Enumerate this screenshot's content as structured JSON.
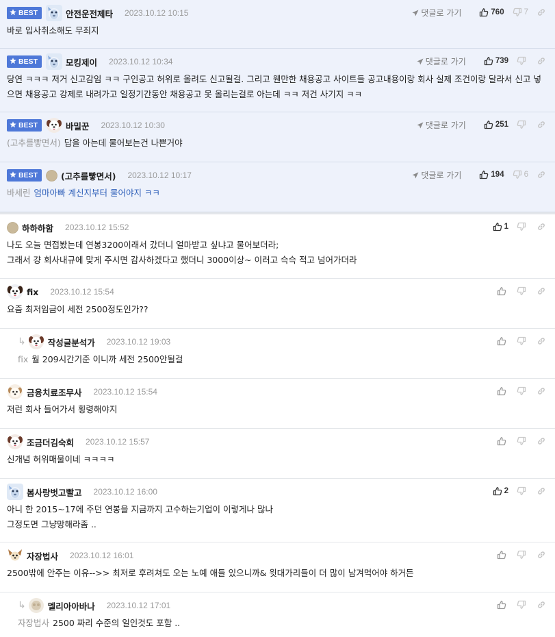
{
  "ui": {
    "goto_label": "댓글로 가기",
    "best_label": "BEST"
  },
  "comments": [
    {
      "nick": "안전운전제타",
      "time": "2023.10.12 10:15",
      "best": true,
      "goto": true,
      "up": "760",
      "down": "7",
      "text": "바로 입사취소해도 무죄지",
      "avatar": "blue-pet-avatar"
    },
    {
      "nick": "모킹제이",
      "time": "2023.10.12 10:34",
      "best": true,
      "goto": true,
      "up": "739",
      "down": "",
      "text": "당연 ㅋㅋㅋ 저거 신고감임 ㅋㅋ 구인공고 허위로 올려도 신고될걸. 그리고 웬만한 채용공고 사이트들 공고내용이랑 회사 실제 조건이랑 달라서 신고 넣으면 채용공고 강제로 내려가고 일정기간동안 채용공고 못 올리는걸로 아는데 ㅋㅋ 저건 사기지 ㅋㅋ",
      "avatar": "blue-pet-avatar"
    },
    {
      "nick": "바밀꾼",
      "time": "2023.10.12 10:30",
      "best": true,
      "goto": true,
      "up": "251",
      "down": "",
      "mention": "(고추를빻면서)",
      "text": "답을 아는데 물어보는건 나쁜거야",
      "avatar": "dog-avatar"
    },
    {
      "nick": "(고추를빻면서)",
      "time": "2023.10.12 10:17",
      "best": true,
      "goto": true,
      "up": "194",
      "down": "6",
      "mention": "바세린",
      "text": "엄마아빠 계신지부터 물어야지 ㅋㅋ",
      "avatar": "default-avatar"
    },
    {
      "nick": "하하하함",
      "time": "2023.10.12 15:52",
      "best": false,
      "up": "1",
      "down": "",
      "text": "나도 오늘 면접봤는데 연봉3200이래서 갔더니 얼마받고 싶냐고 물어보더라;\n그래서 걍 회사내규에 맞게 주시면 감사하겠다고 했더니 3000이상~ 이러고 슥슥 적고 넘어가더라",
      "avatar": "default-avatar"
    },
    {
      "nick": "fix",
      "time": "2023.10.12 15:54",
      "best": false,
      "up": "",
      "down": "",
      "text": "요즘 최저임금이 세전 2500정도인가??",
      "avatar": "dog-dark-avatar"
    },
    {
      "nick": "작성글분석가",
      "time": "2023.10.12 19:03",
      "best": false,
      "reply": true,
      "up": "",
      "down": "",
      "mention": "fix",
      "text": "월 209시간기준 이니까 세전 2500안될걸",
      "avatar": "dog-avatar"
    },
    {
      "nick": "금융치료조무사",
      "time": "2023.10.12 15:54",
      "best": false,
      "up": "",
      "down": "",
      "text": "저런 회사 들어가서 횡령해야지",
      "avatar": "puppy-avatar"
    },
    {
      "nick": "조금더김숙희",
      "time": "2023.10.12 15:57",
      "best": false,
      "up": "",
      "down": "",
      "text": "신개념 허위매물이네 ㅋㅋㅋㅋ",
      "avatar": "dog-avatar"
    },
    {
      "nick": "봄사랑벗고빨고",
      "time": "2023.10.12 16:00",
      "best": false,
      "up": "2",
      "down": "",
      "text": "아니 한 2015~17에 주던 연봉을 지금까지 고수하는기업이 이렇게나 많나\n그정도면 그냥망해라좀 ..",
      "avatar": "blue-pet-avatar"
    },
    {
      "nick": "자장법사",
      "time": "2023.10.12 16:01",
      "best": false,
      "up": "",
      "down": "",
      "text": "2500밖에 안주는 이유-->> 최저로 후려쳐도 오는 노예 애들 있으니까& 윗대가리들이 더 많이 남겨먹어야 하거든",
      "avatar": "chihuahua-avatar"
    },
    {
      "nick": "멜리아아바나",
      "time": "2023.10.12 17:01",
      "best": false,
      "reply": true,
      "up": "",
      "down": "",
      "mention": "자장법사",
      "text": "2500 짜리 수준의 일인것도 포함 ..",
      "avatar": "blurred-avatar"
    }
  ]
}
